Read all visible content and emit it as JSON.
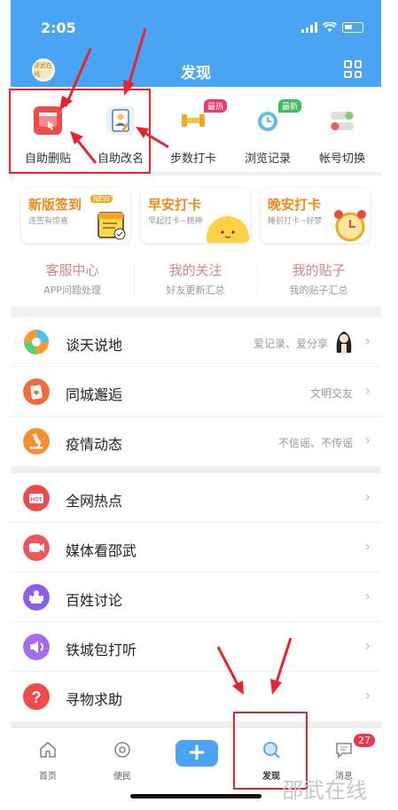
{
  "status": {
    "time": "2:05"
  },
  "header": {
    "title": "发现",
    "avatar_text": "邵武在线"
  },
  "tools": [
    {
      "label": "自助删贴",
      "icon": "delete-post-icon"
    },
    {
      "label": "自助改名",
      "icon": "rename-icon"
    },
    {
      "label": "步数打卡",
      "icon": "dumbbell-icon",
      "badge": "最热"
    },
    {
      "label": "浏览记录",
      "icon": "history-icon",
      "badge": "最新"
    },
    {
      "label": "帐号切换",
      "icon": "toggle-icon"
    }
  ],
  "cards": [
    {
      "title": "新版签到",
      "tag": "NEW",
      "sub": "连签有惊喜",
      "color": "#f08a1a"
    },
    {
      "title": "早安打卡",
      "sub": "早起打卡~精神",
      "color": "#f08a1a"
    },
    {
      "title": "晚安打卡",
      "sub": "睡前打卡~好梦",
      "color": "#f08a1a"
    }
  ],
  "quick": [
    {
      "title": "客服中心",
      "sub": "APP问题处理"
    },
    {
      "title": "我的关注",
      "sub": "好友更新汇总"
    },
    {
      "title": "我的贴子",
      "sub": "我的贴子汇总"
    }
  ],
  "list1": [
    {
      "label": "谈天说地",
      "sub": "爱记录、爱分享",
      "color": "#ff9a2e"
    },
    {
      "label": "同城邂逅",
      "sub": "文明交友",
      "color": "#f26b3a"
    },
    {
      "label": "疫情动态",
      "sub": "不信谣、不传谣",
      "color": "#f5902e"
    }
  ],
  "list2": [
    {
      "label": "全网热点",
      "color": "#f04848"
    },
    {
      "label": "媒体看邵武",
      "color": "#f05656"
    },
    {
      "label": "百姓讨论",
      "color": "#8a5cf0"
    },
    {
      "label": "铁城包打听",
      "color": "#a56cf0"
    },
    {
      "label": "寻物求助",
      "color": "#f04a4a"
    }
  ],
  "tabs": [
    {
      "label": "首页"
    },
    {
      "label": "便民"
    },
    {
      "label": ""
    },
    {
      "label": "发现"
    },
    {
      "label": "消息",
      "badge": "27"
    }
  ],
  "watermark": "邵武在线"
}
